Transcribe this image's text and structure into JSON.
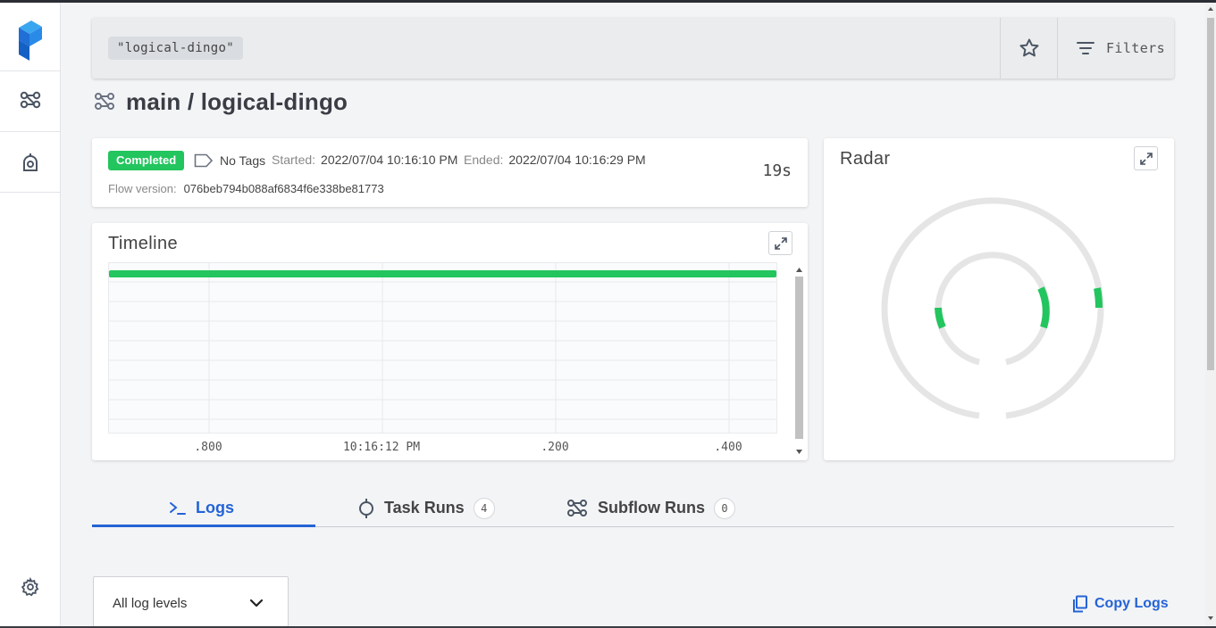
{
  "search": {
    "query_chip": "\"logical-dingo\"",
    "filters_label": "Filters"
  },
  "page": {
    "title": "main / logical-dingo"
  },
  "details": {
    "state": "Completed",
    "tags": "No Tags",
    "started_label": "Started:",
    "started_value": "2022/07/04 10:16:10 PM",
    "ended_label": "Ended:",
    "ended_value": "2022/07/04 10:16:29 PM",
    "version_label": "Flow version:",
    "version_value": "076beb794b088af6834f6e338be81773",
    "duration": "19s"
  },
  "timeline": {
    "title": "Timeline",
    "ticks": [
      ".800",
      "10:16:12 PM",
      ".200",
      ".400"
    ],
    "bar_fraction": 1.0
  },
  "radar": {
    "title": "Radar"
  },
  "tabs": [
    {
      "label": "Logs",
      "count": null,
      "active": true
    },
    {
      "label": "Task Runs",
      "count": "4",
      "active": false
    },
    {
      "label": "Subflow Runs",
      "count": "0",
      "active": false
    }
  ],
  "logs": {
    "level_select": "All log levels",
    "copy_label": "Copy Logs"
  },
  "colors": {
    "accent": "#2463d6",
    "success": "#22c55e"
  }
}
